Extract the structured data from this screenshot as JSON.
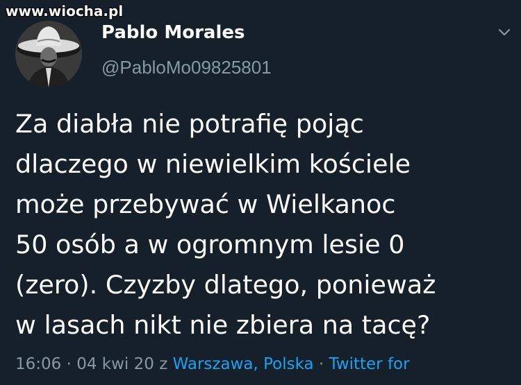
{
  "watermark": {
    "text": "www.wiocha.pl"
  },
  "author": {
    "display_name": "Pablo Morales",
    "handle": "@PabloMo09825801"
  },
  "tweet": {
    "lines": [
      "Za diabła nie potrafię pojąc",
      "dlaczego w niewielkim kościele",
      "może przebywać w Wielkanoc",
      "50 osób a w ogromnym lesie 0",
      "(zero). Czyzby dlatego, ponieważ",
      "w lasach nikt nie zbiera na tacę?"
    ]
  },
  "meta": {
    "timestamp": "16:06 · 04 kwi 20 z ",
    "location": "Warszawa, Polska",
    "separator": " · ",
    "source": "Twitter for"
  },
  "icons": {
    "menu": "chevron-down-icon",
    "avatar": "avatar"
  },
  "colors": {
    "background": "#15202b",
    "text": "#ffffff",
    "secondary": "#8899a6",
    "link": "#1da1f2"
  }
}
